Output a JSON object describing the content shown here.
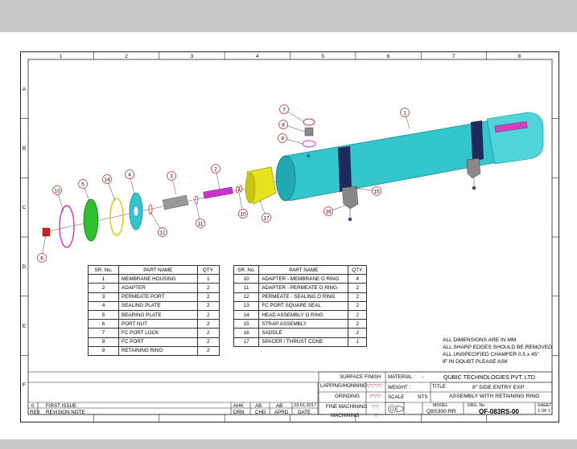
{
  "grid": {
    "columns": [
      "1",
      "2",
      "3",
      "4",
      "5",
      "6",
      "7",
      "8"
    ],
    "rows": [
      "A",
      "B",
      "C",
      "D",
      "E",
      "F"
    ]
  },
  "balloons": [
    "1",
    "2",
    "3",
    "4",
    "5",
    "6",
    "7",
    "8",
    "9",
    "10",
    "11",
    "12",
    "13",
    "14",
    "15",
    "16",
    "17"
  ],
  "parts_table_left": {
    "headers": [
      "SR. No.",
      "PART NAME",
      "QTY."
    ],
    "rows": [
      [
        "1",
        "MEMBRANE HOUSING",
        "1"
      ],
      [
        "2",
        "ADAPTER",
        "2"
      ],
      [
        "3",
        "PERMEATE PORT",
        "2"
      ],
      [
        "4",
        "SEALING PLATE",
        "2"
      ],
      [
        "5",
        "BEARING PLATE",
        "2"
      ],
      [
        "6",
        "PORT NUT",
        "2"
      ],
      [
        "7",
        "FC PORT LOCK",
        "2"
      ],
      [
        "8",
        "FC PORT",
        "2"
      ],
      [
        "9",
        "RETAINING RING",
        "2"
      ]
    ]
  },
  "parts_table_right": {
    "headers": [
      "SR. No.",
      "PART NAME",
      "QTY."
    ],
    "rows": [
      [
        "10",
        "ADAPTER - MEMBRANE O RING",
        "4"
      ],
      [
        "11",
        "ADAPTER - PERMEATE O RING",
        "2"
      ],
      [
        "12",
        "PERMEATE - SEALING O RING",
        "2"
      ],
      [
        "13",
        "FC PORT SQUARE SEAL",
        "2"
      ],
      [
        "14",
        "HEAD ASSEMBLY O RING",
        "2"
      ],
      [
        "15",
        "STRAP ASSEMBLY",
        "2"
      ],
      [
        "16",
        "SADDLE",
        "2"
      ],
      [
        "17",
        "SPACER / THRUST CONE",
        "1"
      ]
    ]
  },
  "notes": [
    "ALL DIMENSIONS ARE IN MM",
    "ALL SHARP EDGES SHOULD BE REMOVED",
    "ALL UNSPECIFIED CHAMFER 0.5 x 45°",
    "IF IN DOUBT PLEASE ASK"
  ],
  "title_block": {
    "surface_finish": "SURFACE FINISH",
    "finishes": [
      {
        "label": "LAPPING/HONNING",
        "symbol": "▽▽▽▽"
      },
      {
        "label": "GRINDING",
        "symbol": "▽▽▽"
      },
      {
        "label": "FINE MACHINING",
        "symbol": "▽▽"
      },
      {
        "label": "MACHINING",
        "symbol": "▽"
      }
    ],
    "material_label": "MATERIAL :",
    "material_value": "-",
    "company": "QUBIC TECHNOLOGIES PVT. LTD.",
    "weight_label": "WEIGHT :",
    "title_label": "TITLE",
    "title_line1": "8\" SIDE ENTRY EXP.",
    "title_line2": "ASSEMBLY WITH RETAINING RING",
    "scale_label": "SCALE",
    "scale_value": "NTS",
    "model_label": "MODEL",
    "model_value": "Q8S300 RR",
    "drg_label": "DRG. No.",
    "drg_value": "QF-083RS-00",
    "sheet_label": "SHEET",
    "sheet_value": "1 OF 1"
  },
  "revision_block": {
    "rev_no": "0",
    "rev_note": "FIRST ISSUE",
    "drn": "AHK",
    "chd": "AB",
    "aprd": "AB",
    "date": "23.01.2017",
    "headers": [
      "REV",
      "REVISION NOTE",
      "DRN",
      "CHD",
      "APRD",
      "DATE"
    ]
  },
  "colors": {
    "housing": "#33c6cc",
    "adapter": "#e6e21e",
    "green_plate": "#2fbf2f",
    "magenta": "#cc33cc",
    "balloon": "#cc3333",
    "lines": "#222222"
  }
}
